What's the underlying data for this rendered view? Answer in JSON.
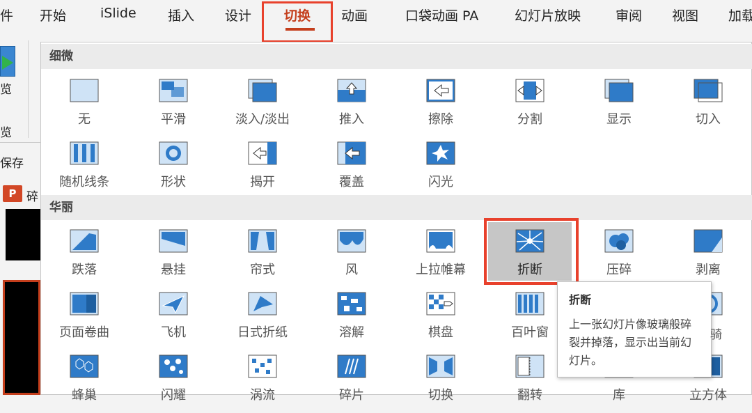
{
  "tabs": [
    {
      "label": "件"
    },
    {
      "label": "开始"
    },
    {
      "label": "iSlide"
    },
    {
      "label": "插入"
    },
    {
      "label": "设计"
    },
    {
      "label": "切换"
    },
    {
      "label": "动画"
    },
    {
      "label": "口袋动画 PA"
    },
    {
      "label": "幻灯片放映"
    },
    {
      "label": "审阅"
    },
    {
      "label": "视图"
    },
    {
      "label": "加载"
    }
  ],
  "active_tab": "切换",
  "left": {
    "preview_label": "览",
    "preview_label2": "览",
    "autosave": "保存",
    "slide_title_char": "碎",
    "ppt_badge": "P"
  },
  "sections": [
    {
      "title": "细微",
      "items": [
        {
          "label": "无",
          "icon": "none-icon"
        },
        {
          "label": "平滑",
          "icon": "morph-icon"
        },
        {
          "label": "淡入/淡出",
          "icon": "fade-icon"
        },
        {
          "label": "推入",
          "icon": "push-icon"
        },
        {
          "label": "擦除",
          "icon": "wipe-icon"
        },
        {
          "label": "分割",
          "icon": "split-icon"
        },
        {
          "label": "显示",
          "icon": "reveal-icon"
        },
        {
          "label": "切入",
          "icon": "cut-icon"
        },
        {
          "label": "随机线条",
          "icon": "random-bars-icon"
        },
        {
          "label": "形状",
          "icon": "shape-icon"
        },
        {
          "label": "揭开",
          "icon": "uncover-icon"
        },
        {
          "label": "覆盖",
          "icon": "cover-icon"
        },
        {
          "label": "闪光",
          "icon": "flash-icon"
        }
      ]
    },
    {
      "title": "华丽",
      "items": [
        {
          "label": "跌落",
          "icon": "fall-over-icon"
        },
        {
          "label": "悬挂",
          "icon": "drape-icon"
        },
        {
          "label": "帘式",
          "icon": "curtains-icon"
        },
        {
          "label": "风",
          "icon": "wind-icon"
        },
        {
          "label": "上拉帷幕",
          "icon": "prestige-icon"
        },
        {
          "label": "折断",
          "icon": "fracture-icon",
          "selected": true
        },
        {
          "label": "压碎",
          "icon": "crush-icon"
        },
        {
          "label": "剥离",
          "icon": "peel-off-icon"
        },
        {
          "label": "页面卷曲",
          "icon": "page-curl-icon"
        },
        {
          "label": "飞机",
          "icon": "airplane-icon"
        },
        {
          "label": "日式折纸",
          "icon": "origami-icon"
        },
        {
          "label": "溶解",
          "icon": "dissolve-icon"
        },
        {
          "label": "棋盘",
          "icon": "checkerboard-icon"
        },
        {
          "label": "百叶窗",
          "icon": "blinds-icon"
        },
        {
          "label": "",
          "icon": "clock-icon"
        },
        {
          "label": "",
          "icon": "ripple-icon"
        },
        {
          "label": "蜂巢",
          "icon": "honeycomb-icon"
        },
        {
          "label": "闪耀",
          "icon": "glitter-icon"
        },
        {
          "label": "涡流",
          "icon": "vortex-icon"
        },
        {
          "label": "碎片",
          "icon": "shred-icon"
        },
        {
          "label": "切换",
          "icon": "switch-icon"
        },
        {
          "label": "翻转",
          "icon": "flip-icon"
        },
        {
          "label": "库",
          "icon": "gallery-icon"
        },
        {
          "label": "立方体",
          "icon": "cube-icon"
        }
      ]
    }
  ],
  "tooltip": {
    "title": "折断",
    "body": "上一张幻灯片像玻璃般碎裂并掉落，显示出当前幻灯片。",
    "partial_label": "骑"
  },
  "colors": {
    "accent": "#c43e1c",
    "highlight_box": "#e8412c",
    "icon_blue": "#2f7bc8",
    "icon_light": "#cfe3f6"
  }
}
